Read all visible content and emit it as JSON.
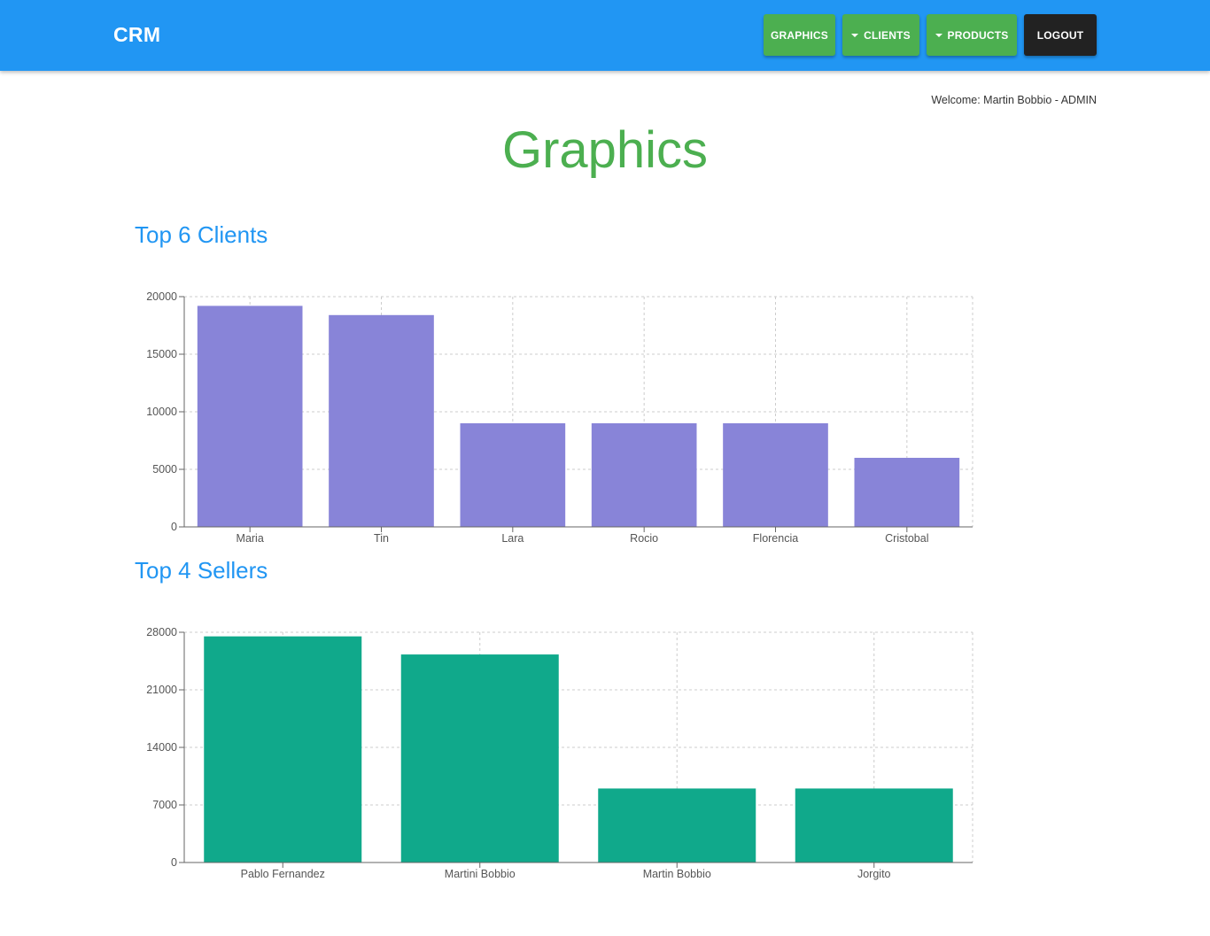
{
  "header": {
    "brand": "CRM",
    "nav": {
      "graphics": "GRAPHICS",
      "clients": "CLIENTS",
      "products": "PRODUCTS",
      "logout": "LOGOUT"
    }
  },
  "welcome": "Welcome: Martin Bobbio - ADMIN",
  "page_title": "Graphics",
  "sections": {
    "clients_title": "Top 6 Clients",
    "sellers_title": "Top 4 Sellers"
  },
  "colors": {
    "navbar": "#2196f3",
    "nav_green": "#4caf50",
    "clients_bar": "#8884d8",
    "sellers_bar": "#10a98b"
  },
  "chart_data": [
    {
      "type": "bar",
      "categories": [
        "Maria",
        "Tin",
        "Lara",
        "Rocio",
        "Florencia",
        "Cristobal"
      ],
      "values": [
        19200,
        18400,
        9000,
        9000,
        9000,
        6000
      ],
      "yticks": [
        0,
        5000,
        10000,
        15000,
        20000
      ],
      "ylim": [
        0,
        20000
      ],
      "grid": true,
      "color": "#8884d8"
    },
    {
      "type": "bar",
      "categories": [
        "Pablo Fernandez",
        "Martini Bobbio",
        "Martin Bobbio",
        "Jorgito"
      ],
      "values": [
        27500,
        25300,
        9000,
        9000
      ],
      "yticks": [
        0,
        7000,
        14000,
        21000,
        28000
      ],
      "ylim": [
        0,
        28000
      ],
      "grid": true,
      "color": "#10a98b"
    }
  ]
}
